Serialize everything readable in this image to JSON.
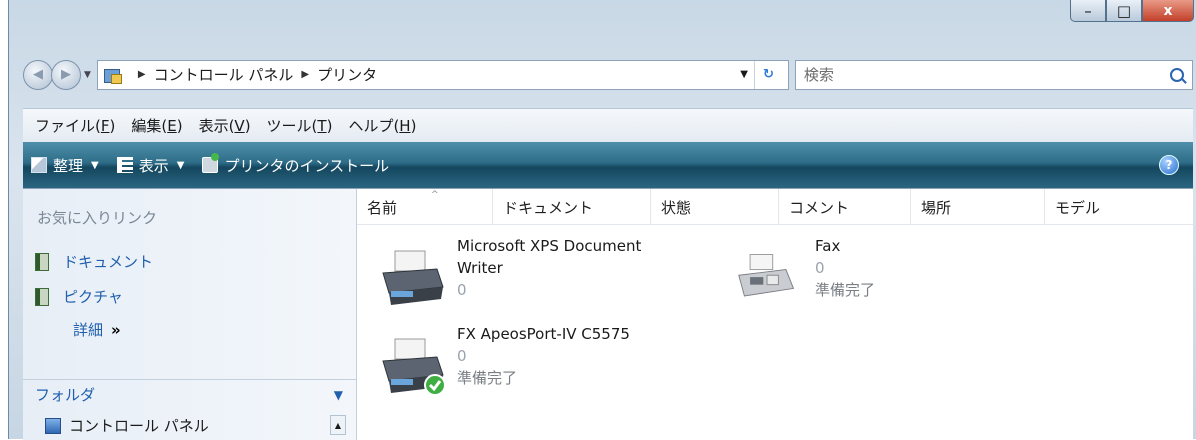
{
  "window": {
    "caption": {
      "minimize": "–",
      "maximize": "□",
      "close": "x"
    }
  },
  "address_bar": {
    "crumbs": [
      "コントロール パネル",
      "プリンタ"
    ],
    "search_placeholder": "検索"
  },
  "menu": {
    "items": [
      {
        "label": "ファイル(",
        "accel": "F",
        "tail": ")"
      },
      {
        "label": "編集(",
        "accel": "E",
        "tail": ")"
      },
      {
        "label": "表示(",
        "accel": "V",
        "tail": ")"
      },
      {
        "label": "ツール(",
        "accel": "T",
        "tail": ")"
      },
      {
        "label": "ヘルプ(",
        "accel": "H",
        "tail": ")"
      }
    ]
  },
  "command_bar": {
    "organize": "整理",
    "views": "表示",
    "add_printer": "プリンタのインストール",
    "help": "?"
  },
  "nav_pane": {
    "favorites_title": "お気に入りリンク",
    "favorites": [
      "ドキュメント",
      "ピクチャ"
    ],
    "more": "詳細",
    "more_arrows": "»",
    "folders_title": "フォルダ",
    "tree_item": "コントロール パネル"
  },
  "columns": [
    "名前",
    "ドキュメント",
    "状態",
    "コメント",
    "場所",
    "モデル"
  ],
  "printers": [
    {
      "name_line1": "Microsoft XPS Document",
      "name_line2": "Writer",
      "documents": "0",
      "status": ""
    },
    {
      "name_line1": "Fax",
      "name_line2": "",
      "documents": "0",
      "status": "準備完了"
    },
    {
      "name_line1": "FX ApeosPort-IV C5575",
      "name_line2": "",
      "documents": "0",
      "status": "準備完了"
    }
  ]
}
